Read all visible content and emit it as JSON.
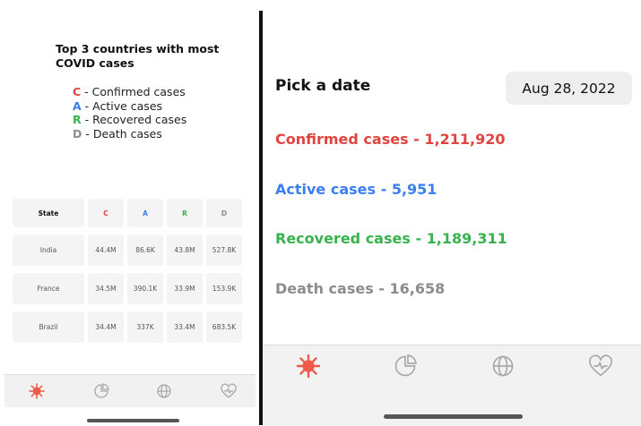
{
  "colors": {
    "confirmed": "#e0443e",
    "active": "#3a7ff0",
    "recovered": "#38b24e",
    "death": "#8c8c8c",
    "tab_active": "#f05a4a",
    "tab_inactive": "#a8a8a8"
  },
  "left_screen": {
    "title": "Top 3 countries with most COVID cases",
    "legend": [
      {
        "key": "C",
        "sep": " - ",
        "label": "Confirmed cases"
      },
      {
        "key": "A",
        "sep": " - ",
        "label": "Active cases"
      },
      {
        "key": "R",
        "sep": " - ",
        "label": "Recovered cases"
      },
      {
        "key": "D",
        "sep": " - ",
        "label": "Death cases"
      }
    ],
    "table": {
      "headers": [
        "State",
        "C",
        "A",
        "R",
        "D"
      ],
      "rows": [
        [
          "India",
          "44.4M",
          "86.6K",
          "43.8M",
          "527.8K"
        ],
        [
          "France",
          "34.5M",
          "390.1K",
          "33.9M",
          "153.9K"
        ],
        [
          "Brazil",
          "34.4M",
          "337K",
          "33.4M",
          "683.5K"
        ]
      ]
    },
    "tabs": [
      {
        "icon": "virus-icon",
        "active": true
      },
      {
        "icon": "pie-chart-icon",
        "active": false
      },
      {
        "icon": "globe-icon",
        "active": false
      },
      {
        "icon": "heart-pulse-icon",
        "active": false
      }
    ]
  },
  "right_screen": {
    "pick_label": "Pick a date",
    "date_value": "Aug 28, 2022",
    "stats": {
      "confirmed": "Confirmed cases - 1,211,920",
      "active": "Active cases - 5,951",
      "recovered": "Recovered cases - 1,189,311",
      "death": "Death cases - 16,658"
    },
    "tabs": [
      {
        "icon": "virus-icon",
        "active": true
      },
      {
        "icon": "pie-chart-icon",
        "active": false
      },
      {
        "icon": "globe-icon",
        "active": false
      },
      {
        "icon": "heart-pulse-icon",
        "active": false
      }
    ]
  }
}
